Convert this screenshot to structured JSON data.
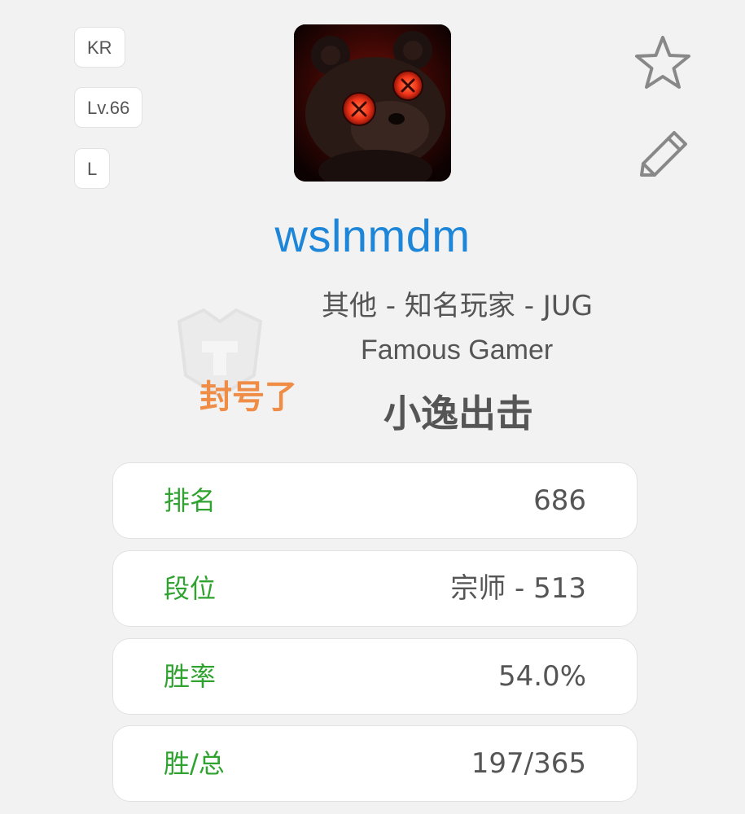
{
  "tags": {
    "region": "KR",
    "level": "Lv.66",
    "tier_short": "L"
  },
  "player": {
    "name": "wslnmdm",
    "team_line": "其他 - 知名玩家 - JUG",
    "team_line_en": "Famous Gamer",
    "banned_note": "封号了",
    "alias": "小逸出击"
  },
  "stats": [
    {
      "label": "排名",
      "value": "686"
    },
    {
      "label": "段位",
      "value": "宗师 - 513"
    },
    {
      "label": "胜率",
      "value": "54.0%"
    },
    {
      "label": "胜/总",
      "value": "197/365"
    }
  ],
  "icons": {
    "favorite": "star-icon",
    "edit": "pencil-icon",
    "avatar": "profile-avatar-image",
    "watermark": "logo-watermark"
  },
  "colors": {
    "background": "#f2f2f2",
    "name": "#1d86d8",
    "label": "#2fa22f",
    "banned": "#ef8c45",
    "text": "#555555"
  }
}
